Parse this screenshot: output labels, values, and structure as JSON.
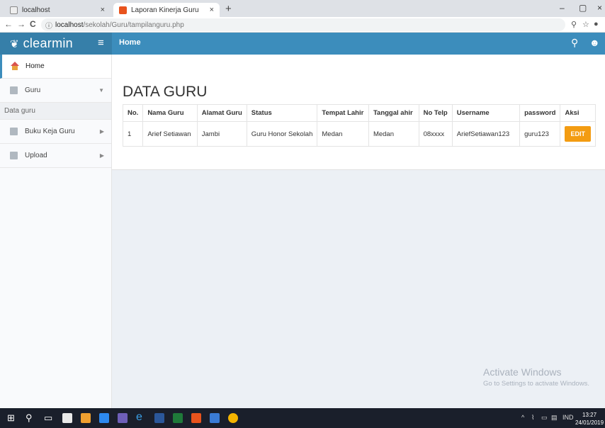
{
  "browser": {
    "tabs": [
      {
        "title": "localhost"
      },
      {
        "title": "Laporan Kinerja Guru"
      }
    ],
    "new_tab": "+",
    "url_host": "localhost",
    "url_path": "/sekolah/Guru/tampilanguru.php",
    "icons": {
      "back": "←",
      "forward": "→",
      "reload": "C",
      "info": "ⓘ",
      "zoom": "⚲",
      "star": "☆",
      "account": "●",
      "tab_close": "×",
      "minimize": "–",
      "maximize": "▢",
      "close": "×"
    }
  },
  "app": {
    "logo_text": "clearmin",
    "header_title": "Home",
    "accent_color": "#3c8dbc"
  },
  "sidebar": {
    "items": [
      {
        "label": "Home"
      },
      {
        "label": "Guru"
      },
      {
        "label": "Data guru"
      },
      {
        "label": "Buku Keja Guru"
      },
      {
        "label": "Upload"
      }
    ]
  },
  "main": {
    "page_title": "DATA GURU",
    "table": {
      "headers": [
        "No.",
        "Nama Guru",
        "Alamat Guru",
        "Status",
        "Tempat Lahir",
        "Tanggal ahir",
        "No Telp",
        "Username",
        "password",
        "Aksi"
      ],
      "rows": [
        [
          "1",
          "Arief Setiawan",
          "Jambi",
          "Guru Honor Sekolah",
          "Medan",
          "Medan",
          "08xxxx",
          "AriefSetiawan123",
          "guru123",
          "EDIT"
        ]
      ]
    },
    "watermark": {
      "line1": "Activate Windows",
      "line2": "Go to Settings to activate Windows."
    }
  },
  "taskbar": {
    "lang": "IND",
    "time": "13:27",
    "date": "24/01/2019"
  }
}
